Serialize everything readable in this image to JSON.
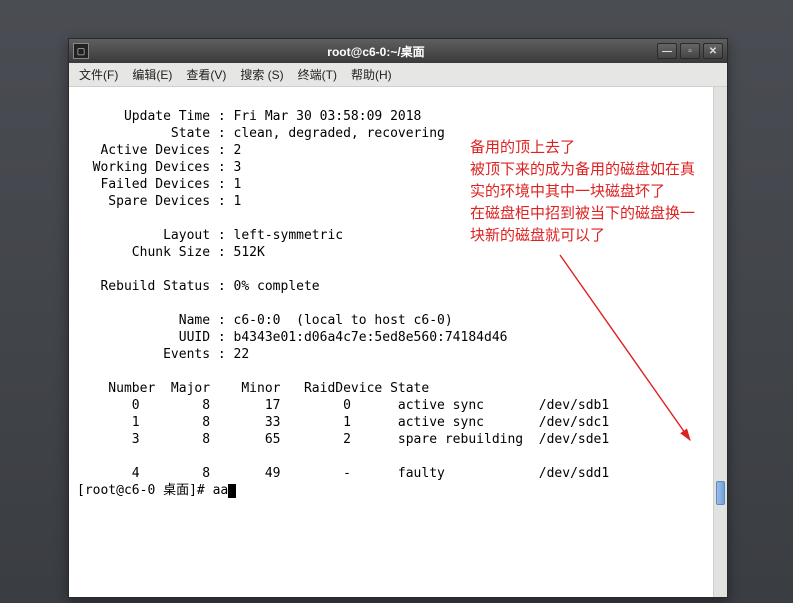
{
  "window": {
    "title": "root@c6-0:~/桌面"
  },
  "menu": {
    "file": "文件(F)",
    "edit": "编辑(E)",
    "view": "查看(V)",
    "search": "搜索 (S)",
    "terminal": "终端(T)",
    "help": "帮助(H)"
  },
  "mdadm": {
    "update_time_label": "Update Time",
    "update_time": "Fri Mar 30 03:58:09 2018",
    "state_label": "State",
    "state": "clean, degraded, recovering",
    "active_devices_label": "Active Devices",
    "active_devices": "2",
    "working_devices_label": "Working Devices",
    "working_devices": "3",
    "failed_devices_label": "Failed Devices",
    "failed_devices": "1",
    "spare_devices_label": "Spare Devices",
    "spare_devices": "1",
    "layout_label": "Layout",
    "layout": "left-symmetric",
    "chunk_size_label": "Chunk Size",
    "chunk_size": "512K",
    "rebuild_status_label": "Rebuild Status",
    "rebuild_status": "0% complete",
    "name_label": "Name",
    "name": "c6-0:0  (local to host c6-0)",
    "uuid_label": "UUID",
    "uuid": "b4343e01:d06a4c7e:5ed8e560:74184d46",
    "events_label": "Events",
    "events": "22",
    "headers": {
      "number": "Number",
      "major": "Major",
      "minor": "Minor",
      "raiddevice": "RaidDevice",
      "state": "State"
    },
    "devices": [
      {
        "number": "0",
        "major": "8",
        "minor": "17",
        "raiddev": "0",
        "state": "active sync",
        "dev": "/dev/sdb1"
      },
      {
        "number": "1",
        "major": "8",
        "minor": "33",
        "raiddev": "1",
        "state": "active sync",
        "dev": "/dev/sdc1"
      },
      {
        "number": "3",
        "major": "8",
        "minor": "65",
        "raiddev": "2",
        "state": "spare rebuilding",
        "dev": "/dev/sde1"
      },
      {
        "number": "4",
        "major": "8",
        "minor": "49",
        "raiddev": "-",
        "state": "faulty",
        "dev": "/dev/sdd1"
      }
    ]
  },
  "prompt": {
    "text": "[root@c6-0 桌面]# ",
    "typed": "aa"
  },
  "annotation": {
    "l1": "备用的顶上去了",
    "l2": "被顶下来的成为备用的磁盘如在真",
    "l3": "实的环境中其中一块磁盘坏了",
    "l4": "在磁盘柜中招到被当下的磁盘换一",
    "l5": "块新的磁盘就可以了"
  },
  "format": {
    "label_pad": 17,
    "dev_num_pad": 8,
    "dev_major_pad": 9,
    "dev_minor_pad": 8,
    "dev_raid_pad": 11,
    "dev_state_pad": 18
  }
}
